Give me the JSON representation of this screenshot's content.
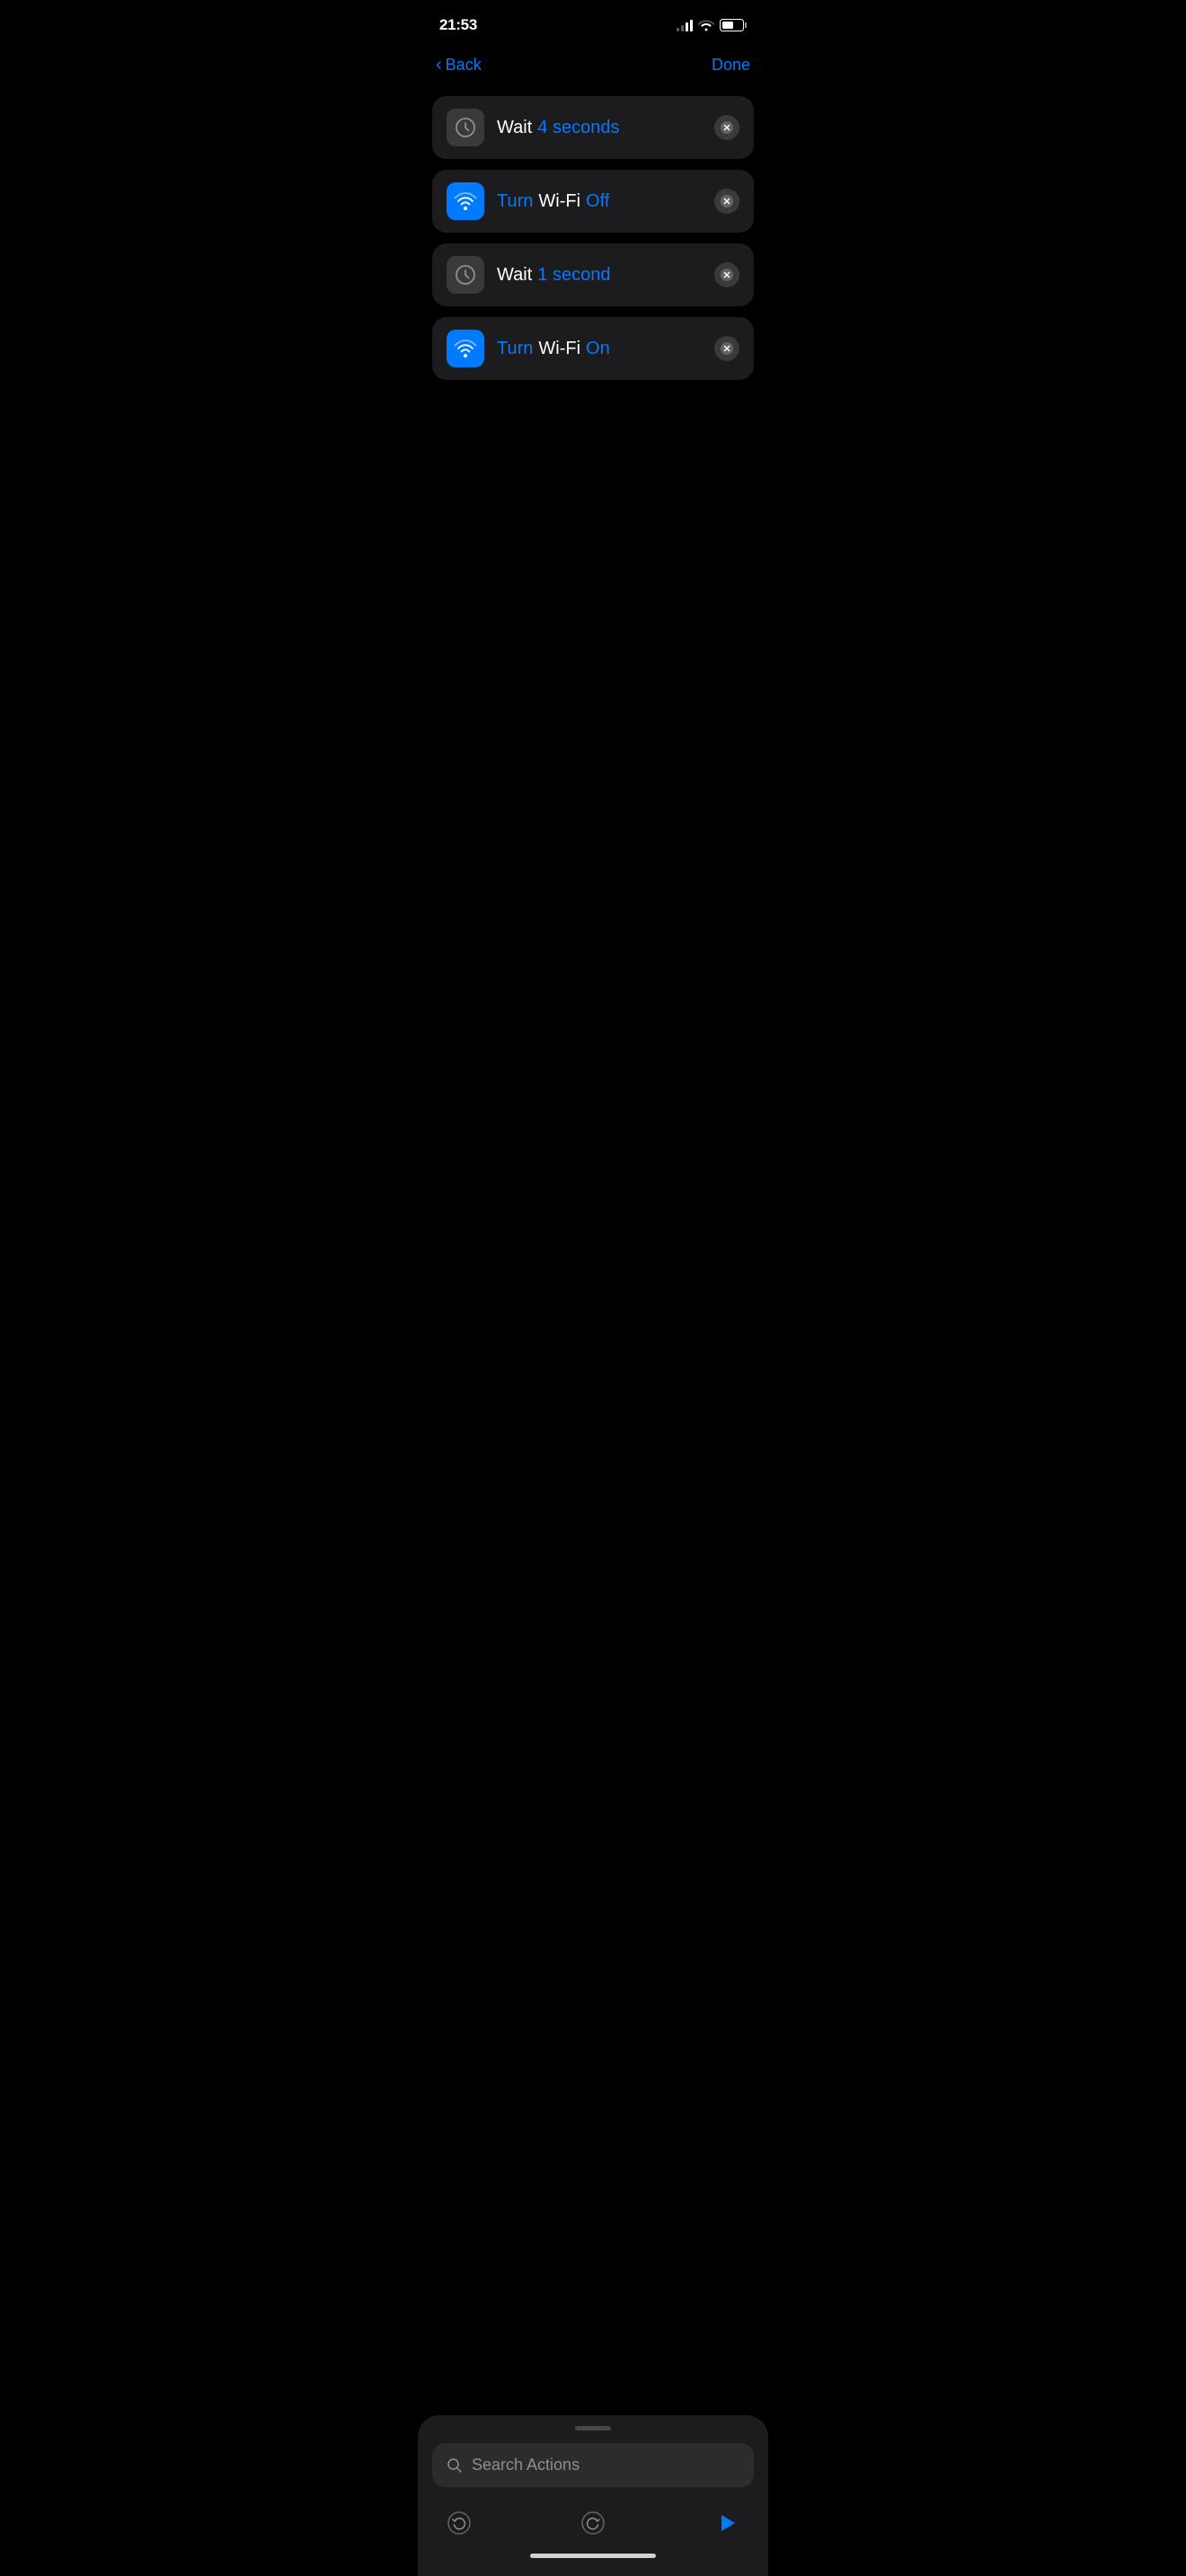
{
  "statusBar": {
    "time": "21:53",
    "signalBars": [
      false,
      false,
      true,
      true
    ],
    "batteryLevel": 55
  },
  "navigation": {
    "backLabel": "Back",
    "doneLabel": "Done"
  },
  "actions": [
    {
      "id": "wait-1",
      "iconType": "clock",
      "parts": [
        {
          "text": "Wait",
          "style": "white"
        },
        {
          "text": "4 seconds",
          "style": "blue"
        }
      ]
    },
    {
      "id": "wifi-off",
      "iconType": "wifi",
      "parts": [
        {
          "text": "Turn",
          "style": "blue"
        },
        {
          "text": "Wi-Fi",
          "style": "white"
        },
        {
          "text": "Off",
          "style": "blue"
        }
      ]
    },
    {
      "id": "wait-2",
      "iconType": "clock",
      "parts": [
        {
          "text": "Wait",
          "style": "white"
        },
        {
          "text": "1 second",
          "style": "blue"
        }
      ]
    },
    {
      "id": "wifi-on",
      "iconType": "wifi",
      "parts": [
        {
          "text": "Turn",
          "style": "blue"
        },
        {
          "text": "Wi-Fi",
          "style": "white"
        },
        {
          "text": "On",
          "style": "blue"
        }
      ]
    }
  ],
  "bottomPanel": {
    "searchPlaceholder": "Search Actions",
    "undoLabel": "undo",
    "redoLabel": "redo",
    "playLabel": "play"
  }
}
